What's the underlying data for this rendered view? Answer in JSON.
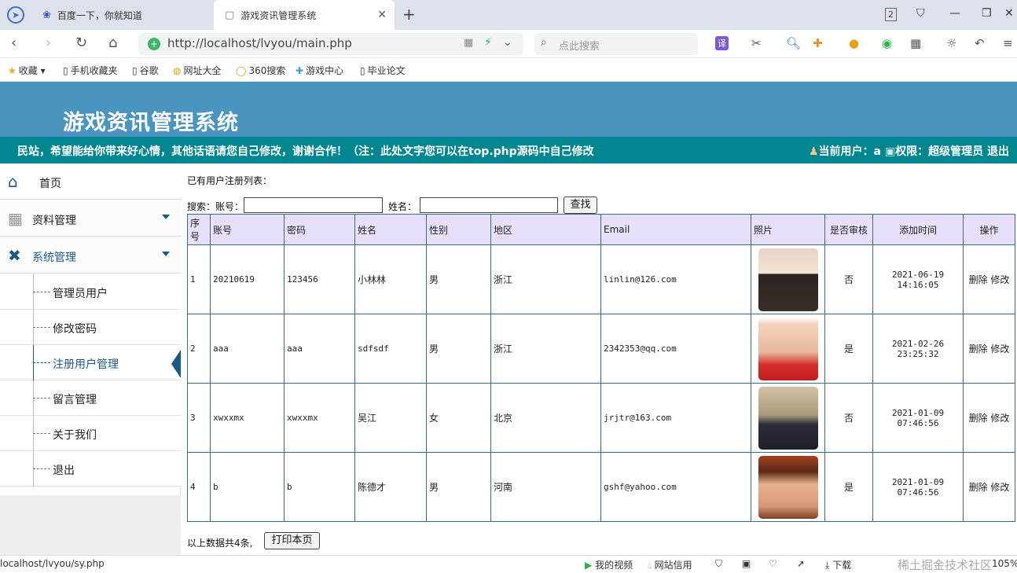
{
  "browser": {
    "tabs": [
      {
        "label": "百度一下，你就知道",
        "icon": "paw-icon"
      },
      {
        "label": "游戏资讯管理系统",
        "icon": "page-icon"
      }
    ],
    "tab_count": "2",
    "url": "http://localhost/lvyou/main.php",
    "search_placeholder": "点此搜索",
    "bookmarks": [
      "收藏",
      "手机收藏夹",
      "谷歌",
      "网址大全",
      "360搜索",
      "游戏中心",
      "毕业论文"
    ]
  },
  "header": {
    "title": "游戏资讯管理系统",
    "marquee": "民站，希望能给你带来好心情，其他话语请您自己修改，谢谢合作！（注：此处文字您可以在top.php源码中自己修改",
    "user_info": "当前用户：a",
    "role_info": "权限：超级管理员",
    "logout": "退出"
  },
  "sidebar": {
    "home": "首页",
    "data_mgmt": "资料管理",
    "sys_mgmt": "系统管理",
    "items": [
      "管理员用户",
      "修改密码",
      "注册用户管理",
      "留言管理",
      "关于我们",
      "退出"
    ]
  },
  "main": {
    "caption": "已有用户注册列表：",
    "search_label": "搜索：账号：",
    "name_label": "姓名：",
    "search_button": "查找",
    "columns": [
      "序号",
      "账号",
      "密码",
      "姓名",
      "性别",
      "地区",
      "Email",
      "照片",
      "是否审核",
      "添加时间",
      "操作"
    ],
    "rows": [
      {
        "no": "1",
        "account": "20210619",
        "password": "123456",
        "name": "小林林",
        "gender": "男",
        "region": "浙江",
        "email": "linlin@126.com",
        "audited": "否",
        "date": "2021-06-19",
        "time": "14:16:05"
      },
      {
        "no": "2",
        "account": "aaa",
        "password": "aaa",
        "name": "sdfsdf",
        "gender": "男",
        "region": "浙江",
        "email": "2342353@qq.com",
        "audited": "是",
        "date": "2021-02-26",
        "time": "23:25:32"
      },
      {
        "no": "3",
        "account": "xwxxmx",
        "password": "xwxxmx",
        "name": "吴江",
        "gender": "女",
        "region": "北京",
        "email": "jrjtr@163.com",
        "audited": "否",
        "date": "2021-01-09",
        "time": "07:46:56"
      },
      {
        "no": "4",
        "account": "b",
        "password": "b",
        "name": "陈德才",
        "gender": "男",
        "region": "河南",
        "email": "gshf@yahoo.com",
        "audited": "是",
        "date": "2021-01-09",
        "time": "07:46:56"
      }
    ],
    "delete_label": "删除",
    "edit_label": "修改",
    "summary": "以上数据共4条,",
    "print_button": "打印本页"
  },
  "status": {
    "link": "localhost/lvyou/sy.php",
    "video": "我的视频",
    "credit": "网站信用",
    "download": "下载",
    "watermark": "稀土掘金技术社区",
    "zoom": "105%"
  }
}
